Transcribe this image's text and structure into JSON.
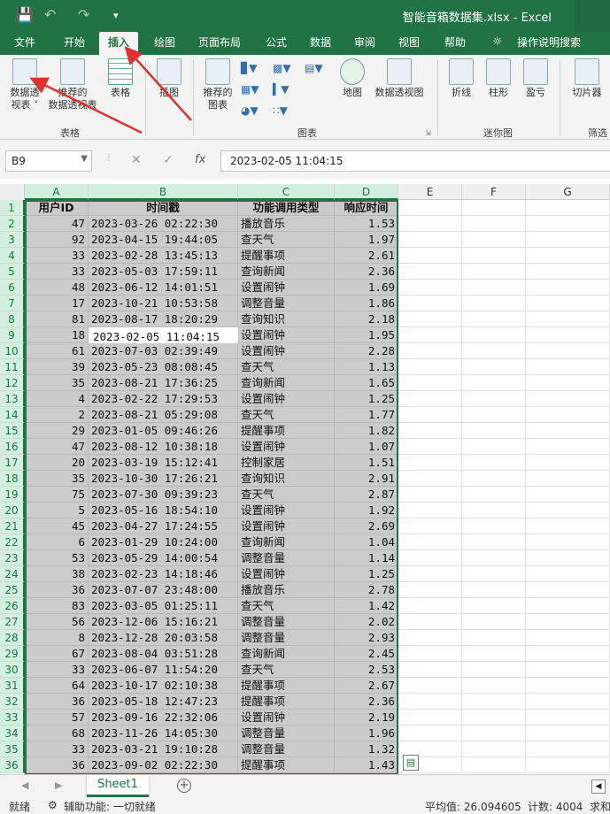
{
  "titlebar": {
    "save_icon": "save-icon",
    "undo_icon": "undo-icon",
    "redo_icon": "redo-icon",
    "title": "智能音箱数据集.xlsx  -  Excel"
  },
  "tabs": [
    {
      "label": "文件"
    },
    {
      "label": "开始"
    },
    {
      "label": "插入"
    },
    {
      "label": "绘图"
    },
    {
      "label": "页面布局"
    },
    {
      "label": "公式"
    },
    {
      "label": "数据"
    },
    {
      "label": "审阅"
    },
    {
      "label": "视图"
    },
    {
      "label": "帮助"
    },
    {
      "label": "操作说明搜索"
    }
  ],
  "ribbon": {
    "pivot": "数据透\n视表 ˅",
    "recommended_pivot": "推荐的\n数据透视表",
    "table": "表格",
    "group_tables": "表格",
    "illustrations": "插图",
    "recommended_charts": "推荐的\n图表",
    "maps": "地图",
    "pivot_chart": "数据透视图",
    "group_charts": "图表",
    "line": "折线",
    "column": "柱形",
    "winloss": "盈亏",
    "group_sparklines": "迷你图",
    "slicer": "切片器",
    "group_filter": "筛选"
  },
  "formula_bar": {
    "name_box": "B9",
    "cancel": "✕",
    "enter": "✓",
    "fx": "fx",
    "value": "2023-02-05 11:04:15"
  },
  "columns": [
    "A",
    "B",
    "C",
    "D",
    "E",
    "F",
    "G"
  ],
  "headers": [
    "用户ID",
    "时间戳",
    "功能调用类型",
    "响应时间"
  ],
  "rows": [
    [
      "47",
      "2023-03-26 02:22:30",
      "播放音乐",
      "1.53"
    ],
    [
      "92",
      "2023-04-15 19:44:05",
      "查天气",
      "1.97"
    ],
    [
      "33",
      "2023-02-28 13:45:13",
      "提醒事项",
      "2.61"
    ],
    [
      "33",
      "2023-05-03 17:59:11",
      "查询新闻",
      "2.36"
    ],
    [
      "48",
      "2023-06-12 14:01:51",
      "设置闹钟",
      "1.69"
    ],
    [
      "17",
      "2023-10-21 10:53:58",
      "调整音量",
      "1.86"
    ],
    [
      "81",
      "2023-08-17 18:20:29",
      "查询知识",
      "2.18"
    ],
    [
      "18",
      "2023-02-05 11:04:15",
      "设置闹钟",
      "1.95"
    ],
    [
      "61",
      "2023-07-03 02:39:49",
      "设置闹钟",
      "2.28"
    ],
    [
      "39",
      "2023-05-23 08:08:45",
      "查天气",
      "1.13"
    ],
    [
      "35",
      "2023-08-21 17:36:25",
      "查询新闻",
      "1.65"
    ],
    [
      "4",
      "2023-02-22 17:29:53",
      "设置闹钟",
      "1.25"
    ],
    [
      "2",
      "2023-08-21 05:29:08",
      "查天气",
      "1.77"
    ],
    [
      "29",
      "2023-01-05 09:46:26",
      "提醒事项",
      "1.82"
    ],
    [
      "47",
      "2023-08-12 10:38:18",
      "设置闹钟",
      "1.07"
    ],
    [
      "20",
      "2023-03-19 15:12:41",
      "控制家居",
      "1.51"
    ],
    [
      "35",
      "2023-10-30 17:26:21",
      "查询知识",
      "2.91"
    ],
    [
      "75",
      "2023-07-30 09:39:23",
      "查天气",
      "2.87"
    ],
    [
      "5",
      "2023-05-16 18:54:10",
      "设置闹钟",
      "1.92"
    ],
    [
      "45",
      "2023-04-27 17:24:55",
      "设置闹钟",
      "2.69"
    ],
    [
      "6",
      "2023-01-29 10:24:00",
      "查询新闻",
      "1.04"
    ],
    [
      "53",
      "2023-05-29 14:00:54",
      "调整音量",
      "1.14"
    ],
    [
      "38",
      "2023-02-23 14:18:46",
      "设置闹钟",
      "1.25"
    ],
    [
      "36",
      "2023-07-07 23:48:00",
      "播放音乐",
      "2.78"
    ],
    [
      "83",
      "2023-03-05 01:25:11",
      "查天气",
      "1.42"
    ],
    [
      "56",
      "2023-12-06 15:16:21",
      "调整音量",
      "2.02"
    ],
    [
      "8",
      "2023-12-28 20:03:58",
      "调整音量",
      "2.93"
    ],
    [
      "67",
      "2023-08-04 03:51:28",
      "查询新闻",
      "2.45"
    ],
    [
      "33",
      "2023-06-07 11:54:20",
      "查天气",
      "2.53"
    ],
    [
      "64",
      "2023-10-17 02:10:38",
      "提醒事项",
      "2.67"
    ],
    [
      "36",
      "2023-05-18 12:47:23",
      "提醒事项",
      "2.36"
    ],
    [
      "57",
      "2023-09-16 22:32:06",
      "设置闹钟",
      "2.19"
    ],
    [
      "68",
      "2023-11-26 14:05:30",
      "调整音量",
      "1.96"
    ],
    [
      "33",
      "2023-03-21 19:10:28",
      "调整音量",
      "1.32"
    ],
    [
      "36",
      "2023-09-02 02:22:30",
      "提醒事项",
      "1.43"
    ]
  ],
  "sheet": {
    "tab": "Sheet1",
    "add": "+"
  },
  "status": {
    "ready": "就绪",
    "accessibility": "辅助功能: 一切就绪",
    "average": "平均值: 26.094605",
    "count": "计数: 4004",
    "sum": "求和"
  },
  "colors": {
    "accent": "#217346",
    "selection": "#cbcbcb",
    "arrow": "#e03030"
  }
}
